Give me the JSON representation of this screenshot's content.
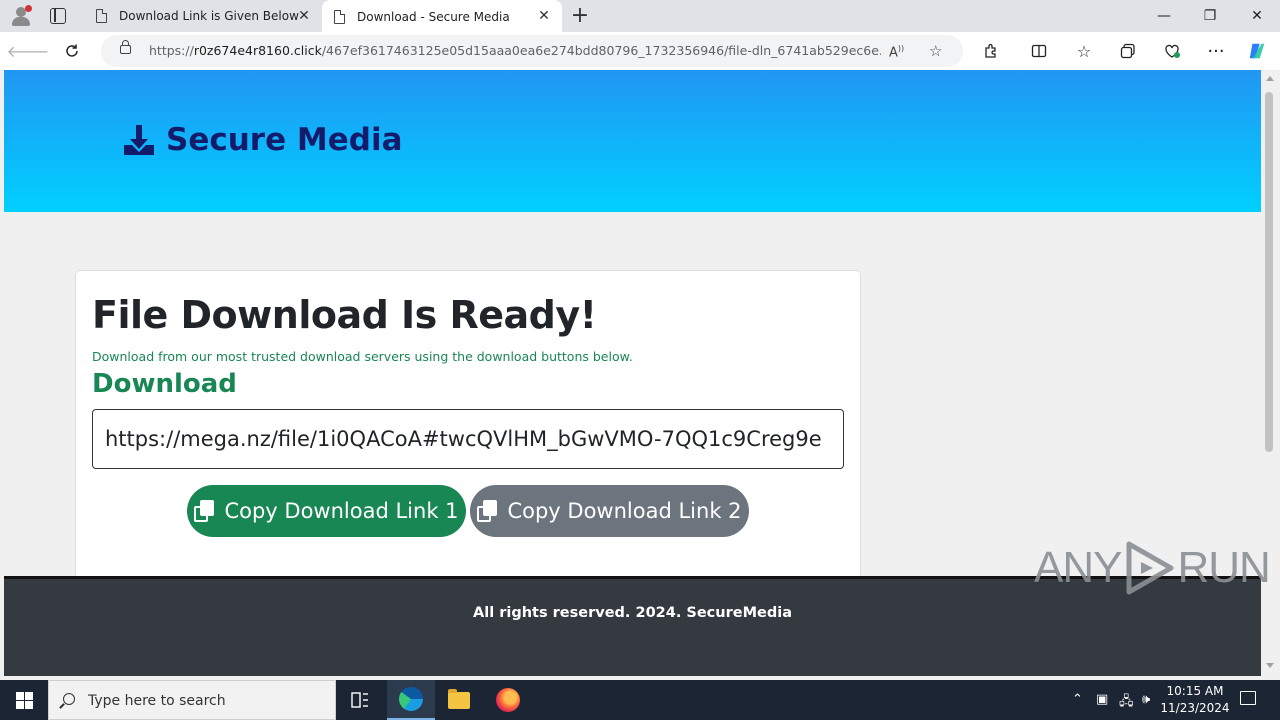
{
  "browser": {
    "tabs": [
      {
        "title": "Download Link is Given Below",
        "active": false
      },
      {
        "title": "Download - Secure Media",
        "active": true
      }
    ],
    "url": {
      "prefix": "https://",
      "domain": "r0z674e4r8160.click",
      "path": "/467ef3617463125e05d15aaa0ea6e274bdd80796_1732356946/file-dln_6741ab529ec6e..."
    },
    "window_controls": {
      "minimize": "—",
      "restore": "❐",
      "close": "✕"
    }
  },
  "site": {
    "brand": "Secure Media",
    "heading": "File Download Is Ready!",
    "subtext": "Download from our most trusted download servers using the download buttons below.",
    "download_title": "Download",
    "download_link": "https://mega.nz/file/1i0QACoA#twcQVlHM_bGwVMO-7QQ1c9Creg9e",
    "buttons": {
      "copy1": "Copy Download Link 1",
      "copy2": "Copy Download Link 2"
    },
    "footer": "All rights reserved. 2024. SecureMedia",
    "colors": {
      "hero_top": "#2196f3",
      "hero_bottom": "#00d0ff",
      "brand": "#131b6b",
      "green": "#198754",
      "gray": "#6c757d",
      "footer": "#343a40"
    }
  },
  "watermark": {
    "left": "ANY",
    "right": "RUN"
  },
  "taskbar": {
    "search_placeholder": "Type here to search",
    "time": "10:15 AM",
    "date": "11/23/2024",
    "pinned": [
      "task-view-icon",
      "edge-icon",
      "file-explorer-icon",
      "firefox-icon"
    ]
  }
}
